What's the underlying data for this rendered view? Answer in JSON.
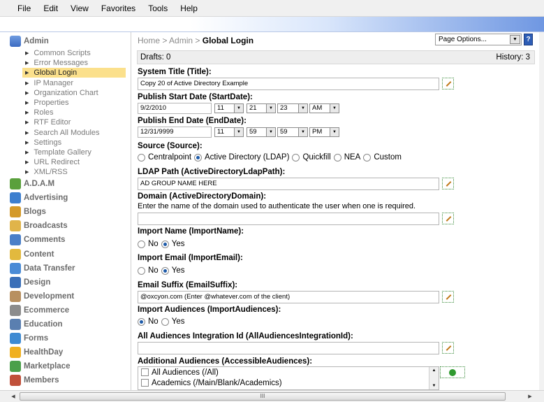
{
  "menu": [
    "File",
    "Edit",
    "View",
    "Favorites",
    "Tools",
    "Help"
  ],
  "nav": {
    "admin_label": "Admin",
    "admin_items": [
      "Common Scripts",
      "Error Messages",
      "Global Login",
      "IP Manager",
      "Organization Chart",
      "Properties",
      "Roles",
      "RTF Editor",
      "Search All Modules",
      "Settings",
      "Template Gallery",
      "URL Redirect",
      "XML/RSS"
    ],
    "active_item": "Global Login",
    "categories": [
      {
        "label": "A.D.A.M",
        "icon": "palm-tree-icon",
        "color": "#5aa03c"
      },
      {
        "label": "Advertising",
        "icon": "advertising-icon",
        "color": "#3d7fcf"
      },
      {
        "label": "Blogs",
        "icon": "blog-pencil-icon",
        "color": "#d49a2a"
      },
      {
        "label": "Broadcasts",
        "icon": "broadcast-envelope-icon",
        "color": "#e0b44a"
      },
      {
        "label": "Comments",
        "icon": "comments-icon",
        "color": "#4a7fc8"
      },
      {
        "label": "Content",
        "icon": "content-folder-icon",
        "color": "#e2b93e"
      },
      {
        "label": "Data Transfer",
        "icon": "data-transfer-icon",
        "color": "#4a8bd6"
      },
      {
        "label": "Design",
        "icon": "design-icon",
        "color": "#3a6fb8"
      },
      {
        "label": "Development",
        "icon": "development-box-icon",
        "color": "#b89060"
      },
      {
        "label": "Ecommerce",
        "icon": "ecommerce-icon",
        "color": "#8c8c8c"
      },
      {
        "label": "Education",
        "icon": "education-book-icon",
        "color": "#5a7fb0"
      },
      {
        "label": "Forms",
        "icon": "forms-icon",
        "color": "#3e8ad2"
      },
      {
        "label": "HealthDay",
        "icon": "sun-icon",
        "color": "#f0b020"
      },
      {
        "label": "Marketplace",
        "icon": "marketplace-icon",
        "color": "#4aa04a"
      },
      {
        "label": "Members",
        "icon": "members-icon",
        "color": "#c0503a"
      }
    ]
  },
  "breadcrumb": {
    "home": "Home",
    "sep1": ">",
    "admin": "Admin",
    "sep2": ">",
    "current": "Global Login"
  },
  "page_options": "Page Options...",
  "help_label": "?",
  "drafts": "Drafts: 0",
  "history": "History: 3",
  "form": {
    "title_label": "System Title (Title):",
    "title_value": "Copy 20 of Active Directory Example",
    "start_label": "Publish Start Date (StartDate):",
    "start_date": "9/2/2010",
    "start_hour": "11",
    "start_min": "21",
    "start_sec": "23",
    "start_ampm": "AM",
    "end_label": "Publish End Date (EndDate):",
    "end_date": "12/31/9999",
    "end_hour": "11",
    "end_min": "59",
    "end_sec": "59",
    "end_ampm": "PM",
    "source_label": "Source (Source):",
    "source_options": [
      "Centralpoint",
      "Active Directory (LDAP)",
      "Quickfill",
      "NEA",
      "Custom"
    ],
    "source_selected": 1,
    "ldap_label": "LDAP Path (ActiveDirectoryLdapPath):",
    "ldap_value": "AD GROUP NAME HERE",
    "domain_label": "Domain (ActiveDirectoryDomain):",
    "domain_desc": "Enter the name of the domain used to authenticate the user when one is required.",
    "domain_value": "",
    "import_name_label": "Import Name (ImportName):",
    "import_name_no": "No",
    "import_name_yes": "Yes",
    "import_email_label": "Import Email (ImportEmail):",
    "import_email_no": "No",
    "import_email_yes": "Yes",
    "email_suffix_label": "Email Suffix (EmailSuffix):",
    "email_suffix_value": "@oxcyon.com (Enter @whatever.com of the client)",
    "import_aud_label": "Import Audiences (ImportAudiences):",
    "import_aud_no": "No",
    "import_aud_yes": "Yes",
    "all_aud_label": "All Audiences Integration Id (AllAudiencesIntegrationId):",
    "all_aud_value": "",
    "add_aud_label": "Additional Audiences (AccessibleAudiences):",
    "add_aud_items": [
      "All Audiences (/All)",
      "Academics (/Main/Blank/Academics)"
    ]
  },
  "scroll_grip": "III"
}
